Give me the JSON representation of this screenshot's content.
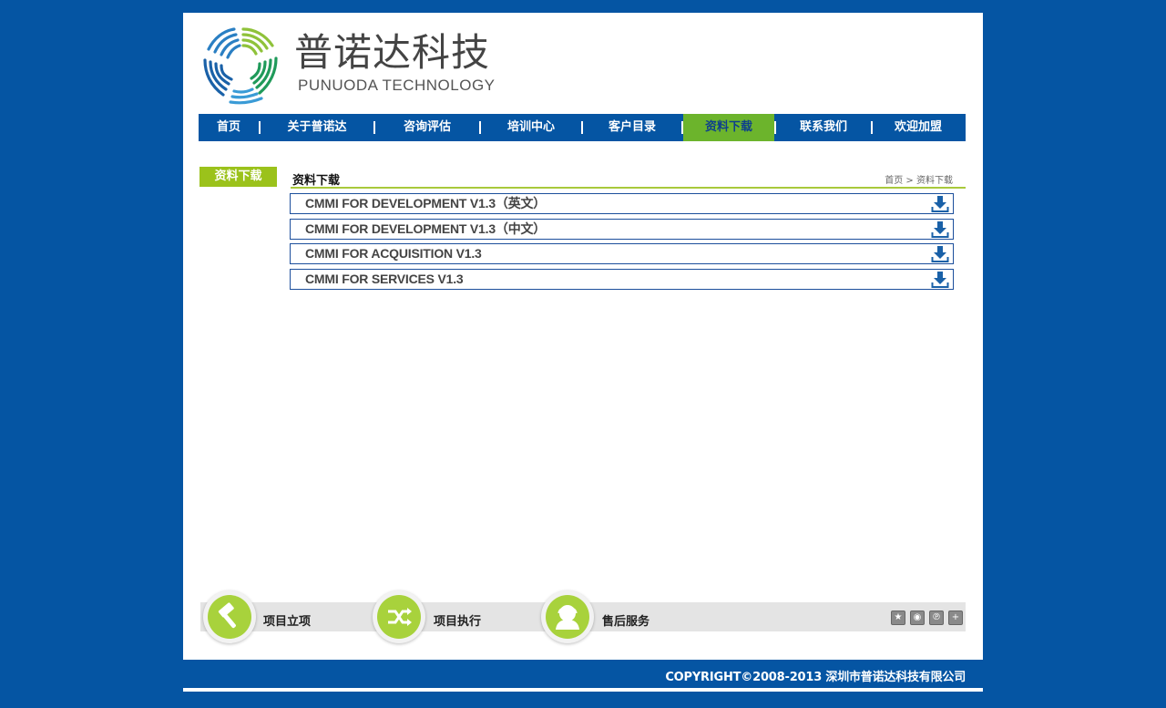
{
  "header": {
    "brand_cn": "普诺达科技",
    "brand_en": "PUNUODA TECHNOLOGY"
  },
  "nav": {
    "items": [
      "首页",
      "关于普诺达",
      "咨询评估",
      "培训中心",
      "客户目录",
      "资料下载",
      "联系我们",
      "欢迎加盟"
    ],
    "active_index": 5
  },
  "sidebar": {
    "title": "资料下载"
  },
  "content": {
    "title": "资料下载",
    "breadcrumb": "首页 > 资料下载",
    "downloads": [
      "CMMI FOR DEVELOPMENT V1.3（英文）",
      "CMMI FOR DEVELOPMENT V1.3（中文）",
      "CMMI FOR ACQUISITION V1.3",
      "CMMI FOR SERVICES V1.3"
    ]
  },
  "services": {
    "items": [
      {
        "label": "项目立项",
        "icon": "hammer-icon"
      },
      {
        "label": "项目执行",
        "icon": "shuffle-icon"
      },
      {
        "label": "售后服务",
        "icon": "support-person-icon"
      }
    ]
  },
  "share": {
    "icons": [
      "qzone-icon",
      "weibo-icon",
      "tencent-weibo-icon",
      "more-share-icon"
    ]
  },
  "footer": {
    "copyright": "COPYRIGHT©2008-2013 深圳市普诺达科技有限公司"
  },
  "colors": {
    "background": "#0555a3",
    "accent_green": "#6cb42c",
    "sidebar_green": "#9bc21b",
    "border_blue": "#1c4f9c"
  }
}
